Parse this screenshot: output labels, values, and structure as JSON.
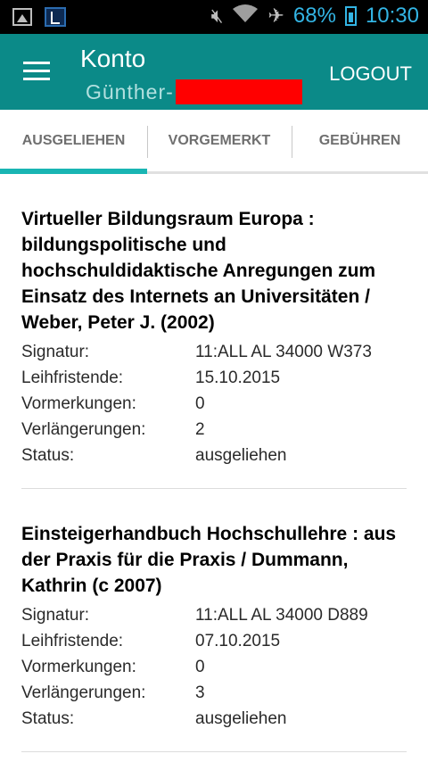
{
  "statusbar": {
    "battery": "68%",
    "time": "10:30"
  },
  "appbar": {
    "title": "Konto",
    "subtitle": "Günther-",
    "logout": "LOGOUT"
  },
  "tabs": [
    {
      "label": "AUSGELIEHEN",
      "active": true
    },
    {
      "label": "VORGEMERKT",
      "active": false
    },
    {
      "label": "GEBÜHREN",
      "active": false
    }
  ],
  "labels": {
    "signatur": "Signatur:",
    "leihfristende": "Leihfristende:",
    "vormerkungen": "Vormerkungen:",
    "verlaengerungen": "Verlängerungen:",
    "status": "Status:"
  },
  "items": [
    {
      "title": "Virtueller Bildungsraum Europa : bildungspolitische und hochschuldidaktische Anregungen zum Einsatz des Internets an Universitäten / Weber, Peter J. (2002)",
      "signatur": "11:ALL AL 34000 W373",
      "leihfristende": "15.10.2015",
      "vormerkungen": "0",
      "verlaengerungen": "2",
      "status": "ausgeliehen"
    },
    {
      "title": "Einsteigerhandbuch Hochschullehre : aus der Praxis für die Praxis / Dummann, Kathrin (c 2007)",
      "signatur": "11:ALL AL 34000 D889",
      "leihfristende": "07.10.2015",
      "vormerkungen": "0",
      "verlaengerungen": "3",
      "status": "ausgeliehen"
    }
  ],
  "colors": {
    "appbar": "#0b8a88",
    "tab_indicator": "#19b5b3",
    "status_accent": "#33b5e5"
  }
}
